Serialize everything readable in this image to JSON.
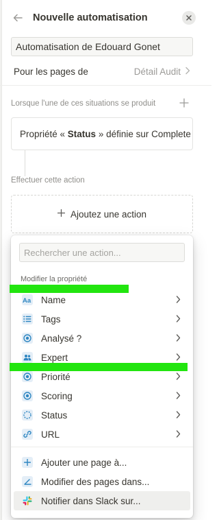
{
  "header": {
    "title": "Nouvelle automatisation",
    "back_icon": "arrow-left-icon",
    "close_icon": "close-icon"
  },
  "automation_name": "Automatisation de Edouard Gonet",
  "pages_row": {
    "label": "Pour les pages de",
    "value": "Détail Audit"
  },
  "trigger": {
    "section_label": "Lorsque l'une de ces situations se produit",
    "prefix": "Propriété « ",
    "property": "Status",
    "suffix": " » définie sur Complete"
  },
  "action": {
    "section_label": "Effectuer cette action",
    "add_label": "Ajoutez une action"
  },
  "menu": {
    "search_placeholder": "Rechercher une action...",
    "section_label": "Modifier la propriété",
    "property_items": [
      {
        "label": "Name",
        "icon": "text-aa-icon"
      },
      {
        "label": "Tags",
        "icon": "multi-select-icon"
      },
      {
        "label": "Analysé ?",
        "icon": "status-circle-icon"
      },
      {
        "label": "Expert",
        "icon": "people-icon"
      },
      {
        "label": "Priorité",
        "icon": "status-circle-icon"
      },
      {
        "label": "Scoring",
        "icon": "status-circle-icon"
      },
      {
        "label": "Status",
        "icon": "status-dashed-icon"
      },
      {
        "label": "URL",
        "icon": "link-icon"
      }
    ],
    "page_items": [
      {
        "label": "Ajouter une page à...",
        "icon": "plus-icon"
      },
      {
        "label": "Modifier des pages dans...",
        "icon": "edit-angle-icon"
      },
      {
        "label": "Notifier dans Slack sur...",
        "icon": "slack-icon"
      }
    ]
  },
  "colors": {
    "text": "#37352f",
    "muted": "#9b9a97",
    "icon_blue": "#2e86c1",
    "icon_bg": "#e4eef7",
    "redaction_green": "#22e50f"
  }
}
